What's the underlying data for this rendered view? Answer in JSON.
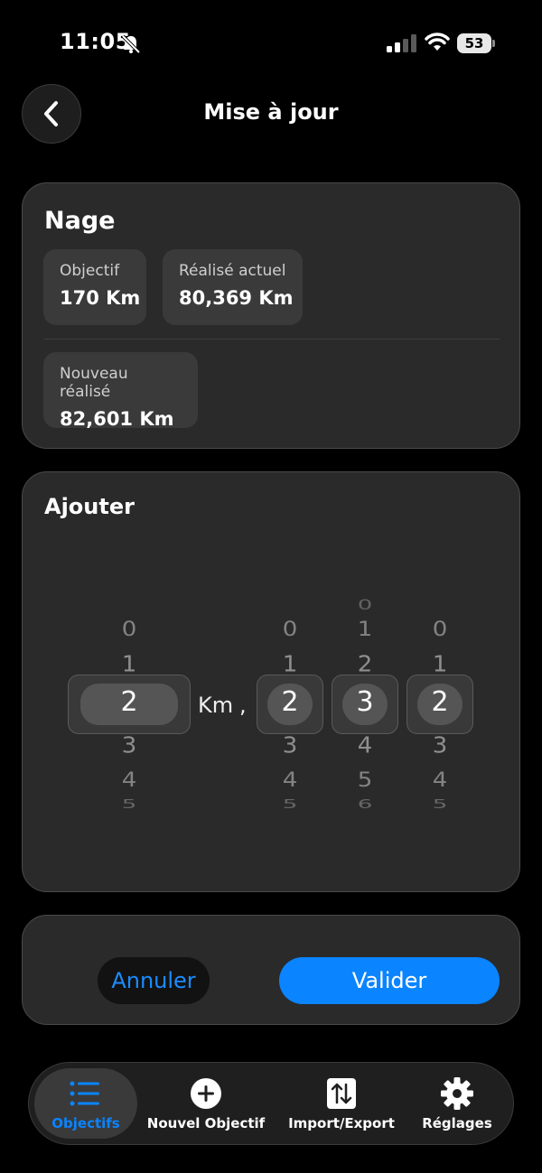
{
  "status_bar": {
    "time": "11:05",
    "battery": "53"
  },
  "header": {
    "title": "Mise à jour"
  },
  "summary": {
    "title": "Nage",
    "goal": {
      "label": "Objectif",
      "value": "170 Km"
    },
    "current": {
      "label": "Réalisé actuel",
      "value": "80,369 Km"
    },
    "new": {
      "label": "Nouveau réalisé",
      "value": "82,601 Km"
    }
  },
  "add": {
    "title": "Ajouter",
    "unit": "Km",
    "separator": ",",
    "km_wheel": {
      "above": [
        "0",
        "1"
      ],
      "selected": "2",
      "below": [
        "3",
        "4",
        "5"
      ]
    },
    "d1_wheel": {
      "above": [
        "0",
        "1"
      ],
      "selected": "2",
      "below": [
        "3",
        "4",
        "5"
      ]
    },
    "d2_wheel": {
      "above": [
        "0",
        "1",
        "2"
      ],
      "selected": "3",
      "below": [
        "4",
        "5",
        "6"
      ]
    },
    "d3_wheel": {
      "above": [
        "0",
        "1"
      ],
      "selected": "2",
      "below": [
        "3",
        "4",
        "5"
      ]
    }
  },
  "actions": {
    "cancel": "Annuler",
    "confirm": "Valider"
  },
  "tabs": [
    {
      "label": "Objectifs",
      "icon": "list-icon",
      "active": true
    },
    {
      "label": "Nouvel Objectif",
      "icon": "plus-circle-icon"
    },
    {
      "label": "Import/Export",
      "icon": "import-export-icon"
    },
    {
      "label": "Réglages",
      "icon": "gear-icon"
    }
  ],
  "colors": {
    "accent": "#0a84ff",
    "card": "#2a2a2a",
    "background": "#000000"
  }
}
